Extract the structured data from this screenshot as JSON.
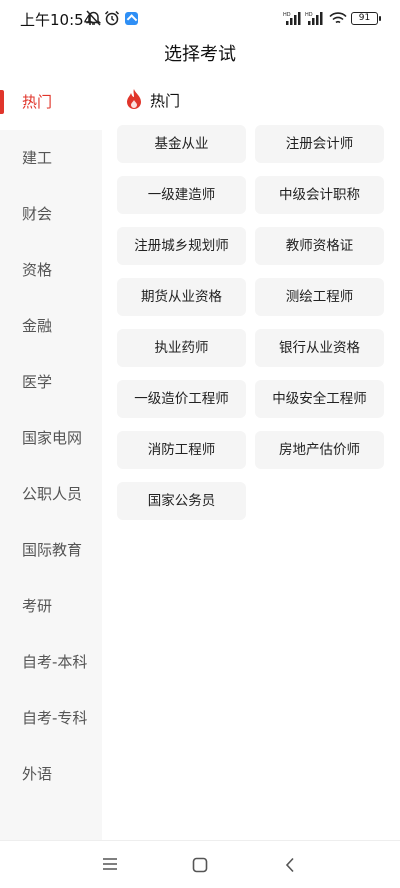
{
  "status_bar": {
    "time": "上午10:54",
    "battery": "91",
    "icons": [
      "bell-off-icon",
      "alarm-icon",
      "app-notification-icon",
      "signal-icon",
      "signal-icon",
      "wifi-icon",
      "battery-icon"
    ]
  },
  "header": {
    "title": "选择考试"
  },
  "sidebar": {
    "items": [
      {
        "label": "热门"
      },
      {
        "label": "建工"
      },
      {
        "label": "财会"
      },
      {
        "label": "资格"
      },
      {
        "label": "金融"
      },
      {
        "label": "医学"
      },
      {
        "label": "国家电网"
      },
      {
        "label": "公职人员"
      },
      {
        "label": "国际教育"
      },
      {
        "label": "考研"
      },
      {
        "label": "自考-本科"
      },
      {
        "label": "自考-专科"
      },
      {
        "label": "外语"
      }
    ]
  },
  "content": {
    "section_title": "热门",
    "section_icon": "flame-icon",
    "accent_color": "#e0352b",
    "exams": [
      "基金从业",
      "注册会计师",
      "一级建造师",
      "中级会计职称",
      "注册城乡规划师",
      "教师资格证",
      "期货从业资格",
      "测绘工程师",
      "执业药师",
      "银行从业资格",
      "一级造价工程师",
      "中级安全工程师",
      "消防工程师",
      "房地产估价师",
      "国家公务员"
    ]
  },
  "nav_bar": {
    "icons": [
      "menu-icon",
      "home-icon",
      "back-icon"
    ]
  }
}
